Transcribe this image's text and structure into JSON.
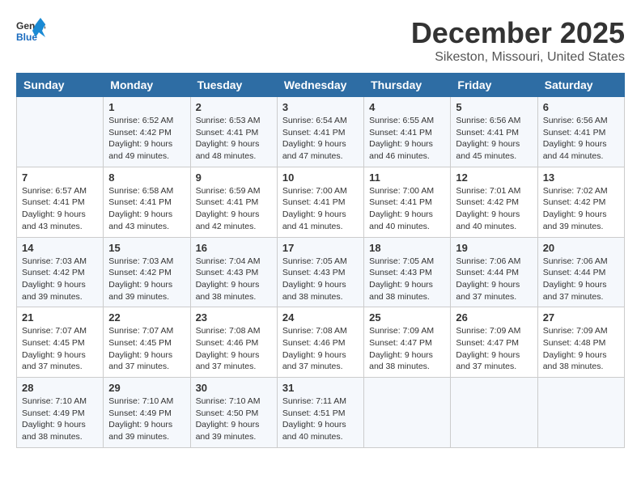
{
  "logo": {
    "line1": "General",
    "line2": "Blue"
  },
  "title": "December 2025",
  "subtitle": "Sikeston, Missouri, United States",
  "headers": [
    "Sunday",
    "Monday",
    "Tuesday",
    "Wednesday",
    "Thursday",
    "Friday",
    "Saturday"
  ],
  "weeks": [
    [
      {
        "date": "",
        "sunrise": "",
        "sunset": "",
        "daylight": ""
      },
      {
        "date": "1",
        "sunrise": "Sunrise: 6:52 AM",
        "sunset": "Sunset: 4:42 PM",
        "daylight": "Daylight: 9 hours and 49 minutes."
      },
      {
        "date": "2",
        "sunrise": "Sunrise: 6:53 AM",
        "sunset": "Sunset: 4:41 PM",
        "daylight": "Daylight: 9 hours and 48 minutes."
      },
      {
        "date": "3",
        "sunrise": "Sunrise: 6:54 AM",
        "sunset": "Sunset: 4:41 PM",
        "daylight": "Daylight: 9 hours and 47 minutes."
      },
      {
        "date": "4",
        "sunrise": "Sunrise: 6:55 AM",
        "sunset": "Sunset: 4:41 PM",
        "daylight": "Daylight: 9 hours and 46 minutes."
      },
      {
        "date": "5",
        "sunrise": "Sunrise: 6:56 AM",
        "sunset": "Sunset: 4:41 PM",
        "daylight": "Daylight: 9 hours and 45 minutes."
      },
      {
        "date": "6",
        "sunrise": "Sunrise: 6:56 AM",
        "sunset": "Sunset: 4:41 PM",
        "daylight": "Daylight: 9 hours and 44 minutes."
      }
    ],
    [
      {
        "date": "7",
        "sunrise": "Sunrise: 6:57 AM",
        "sunset": "Sunset: 4:41 PM",
        "daylight": "Daylight: 9 hours and 43 minutes."
      },
      {
        "date": "8",
        "sunrise": "Sunrise: 6:58 AM",
        "sunset": "Sunset: 4:41 PM",
        "daylight": "Daylight: 9 hours and 43 minutes."
      },
      {
        "date": "9",
        "sunrise": "Sunrise: 6:59 AM",
        "sunset": "Sunset: 4:41 PM",
        "daylight": "Daylight: 9 hours and 42 minutes."
      },
      {
        "date": "10",
        "sunrise": "Sunrise: 7:00 AM",
        "sunset": "Sunset: 4:41 PM",
        "daylight": "Daylight: 9 hours and 41 minutes."
      },
      {
        "date": "11",
        "sunrise": "Sunrise: 7:00 AM",
        "sunset": "Sunset: 4:41 PM",
        "daylight": "Daylight: 9 hours and 40 minutes."
      },
      {
        "date": "12",
        "sunrise": "Sunrise: 7:01 AM",
        "sunset": "Sunset: 4:42 PM",
        "daylight": "Daylight: 9 hours and 40 minutes."
      },
      {
        "date": "13",
        "sunrise": "Sunrise: 7:02 AM",
        "sunset": "Sunset: 4:42 PM",
        "daylight": "Daylight: 9 hours and 39 minutes."
      }
    ],
    [
      {
        "date": "14",
        "sunrise": "Sunrise: 7:03 AM",
        "sunset": "Sunset: 4:42 PM",
        "daylight": "Daylight: 9 hours and 39 minutes."
      },
      {
        "date": "15",
        "sunrise": "Sunrise: 7:03 AM",
        "sunset": "Sunset: 4:42 PM",
        "daylight": "Daylight: 9 hours and 39 minutes."
      },
      {
        "date": "16",
        "sunrise": "Sunrise: 7:04 AM",
        "sunset": "Sunset: 4:43 PM",
        "daylight": "Daylight: 9 hours and 38 minutes."
      },
      {
        "date": "17",
        "sunrise": "Sunrise: 7:05 AM",
        "sunset": "Sunset: 4:43 PM",
        "daylight": "Daylight: 9 hours and 38 minutes."
      },
      {
        "date": "18",
        "sunrise": "Sunrise: 7:05 AM",
        "sunset": "Sunset: 4:43 PM",
        "daylight": "Daylight: 9 hours and 38 minutes."
      },
      {
        "date": "19",
        "sunrise": "Sunrise: 7:06 AM",
        "sunset": "Sunset: 4:44 PM",
        "daylight": "Daylight: 9 hours and 37 minutes."
      },
      {
        "date": "20",
        "sunrise": "Sunrise: 7:06 AM",
        "sunset": "Sunset: 4:44 PM",
        "daylight": "Daylight: 9 hours and 37 minutes."
      }
    ],
    [
      {
        "date": "21",
        "sunrise": "Sunrise: 7:07 AM",
        "sunset": "Sunset: 4:45 PM",
        "daylight": "Daylight: 9 hours and 37 minutes."
      },
      {
        "date": "22",
        "sunrise": "Sunrise: 7:07 AM",
        "sunset": "Sunset: 4:45 PM",
        "daylight": "Daylight: 9 hours and 37 minutes."
      },
      {
        "date": "23",
        "sunrise": "Sunrise: 7:08 AM",
        "sunset": "Sunset: 4:46 PM",
        "daylight": "Daylight: 9 hours and 37 minutes."
      },
      {
        "date": "24",
        "sunrise": "Sunrise: 7:08 AM",
        "sunset": "Sunset: 4:46 PM",
        "daylight": "Daylight: 9 hours and 37 minutes."
      },
      {
        "date": "25",
        "sunrise": "Sunrise: 7:09 AM",
        "sunset": "Sunset: 4:47 PM",
        "daylight": "Daylight: 9 hours and 38 minutes."
      },
      {
        "date": "26",
        "sunrise": "Sunrise: 7:09 AM",
        "sunset": "Sunset: 4:47 PM",
        "daylight": "Daylight: 9 hours and 37 minutes."
      },
      {
        "date": "27",
        "sunrise": "Sunrise: 7:09 AM",
        "sunset": "Sunset: 4:48 PM",
        "daylight": "Daylight: 9 hours and 38 minutes."
      }
    ],
    [
      {
        "date": "28",
        "sunrise": "Sunrise: 7:10 AM",
        "sunset": "Sunset: 4:49 PM",
        "daylight": "Daylight: 9 hours and 38 minutes."
      },
      {
        "date": "29",
        "sunrise": "Sunrise: 7:10 AM",
        "sunset": "Sunset: 4:49 PM",
        "daylight": "Daylight: 9 hours and 39 minutes."
      },
      {
        "date": "30",
        "sunrise": "Sunrise: 7:10 AM",
        "sunset": "Sunset: 4:50 PM",
        "daylight": "Daylight: 9 hours and 39 minutes."
      },
      {
        "date": "31",
        "sunrise": "Sunrise: 7:11 AM",
        "sunset": "Sunset: 4:51 PM",
        "daylight": "Daylight: 9 hours and 40 minutes."
      },
      {
        "date": "",
        "sunrise": "",
        "sunset": "",
        "daylight": ""
      },
      {
        "date": "",
        "sunrise": "",
        "sunset": "",
        "daylight": ""
      },
      {
        "date": "",
        "sunrise": "",
        "sunset": "",
        "daylight": ""
      }
    ]
  ]
}
